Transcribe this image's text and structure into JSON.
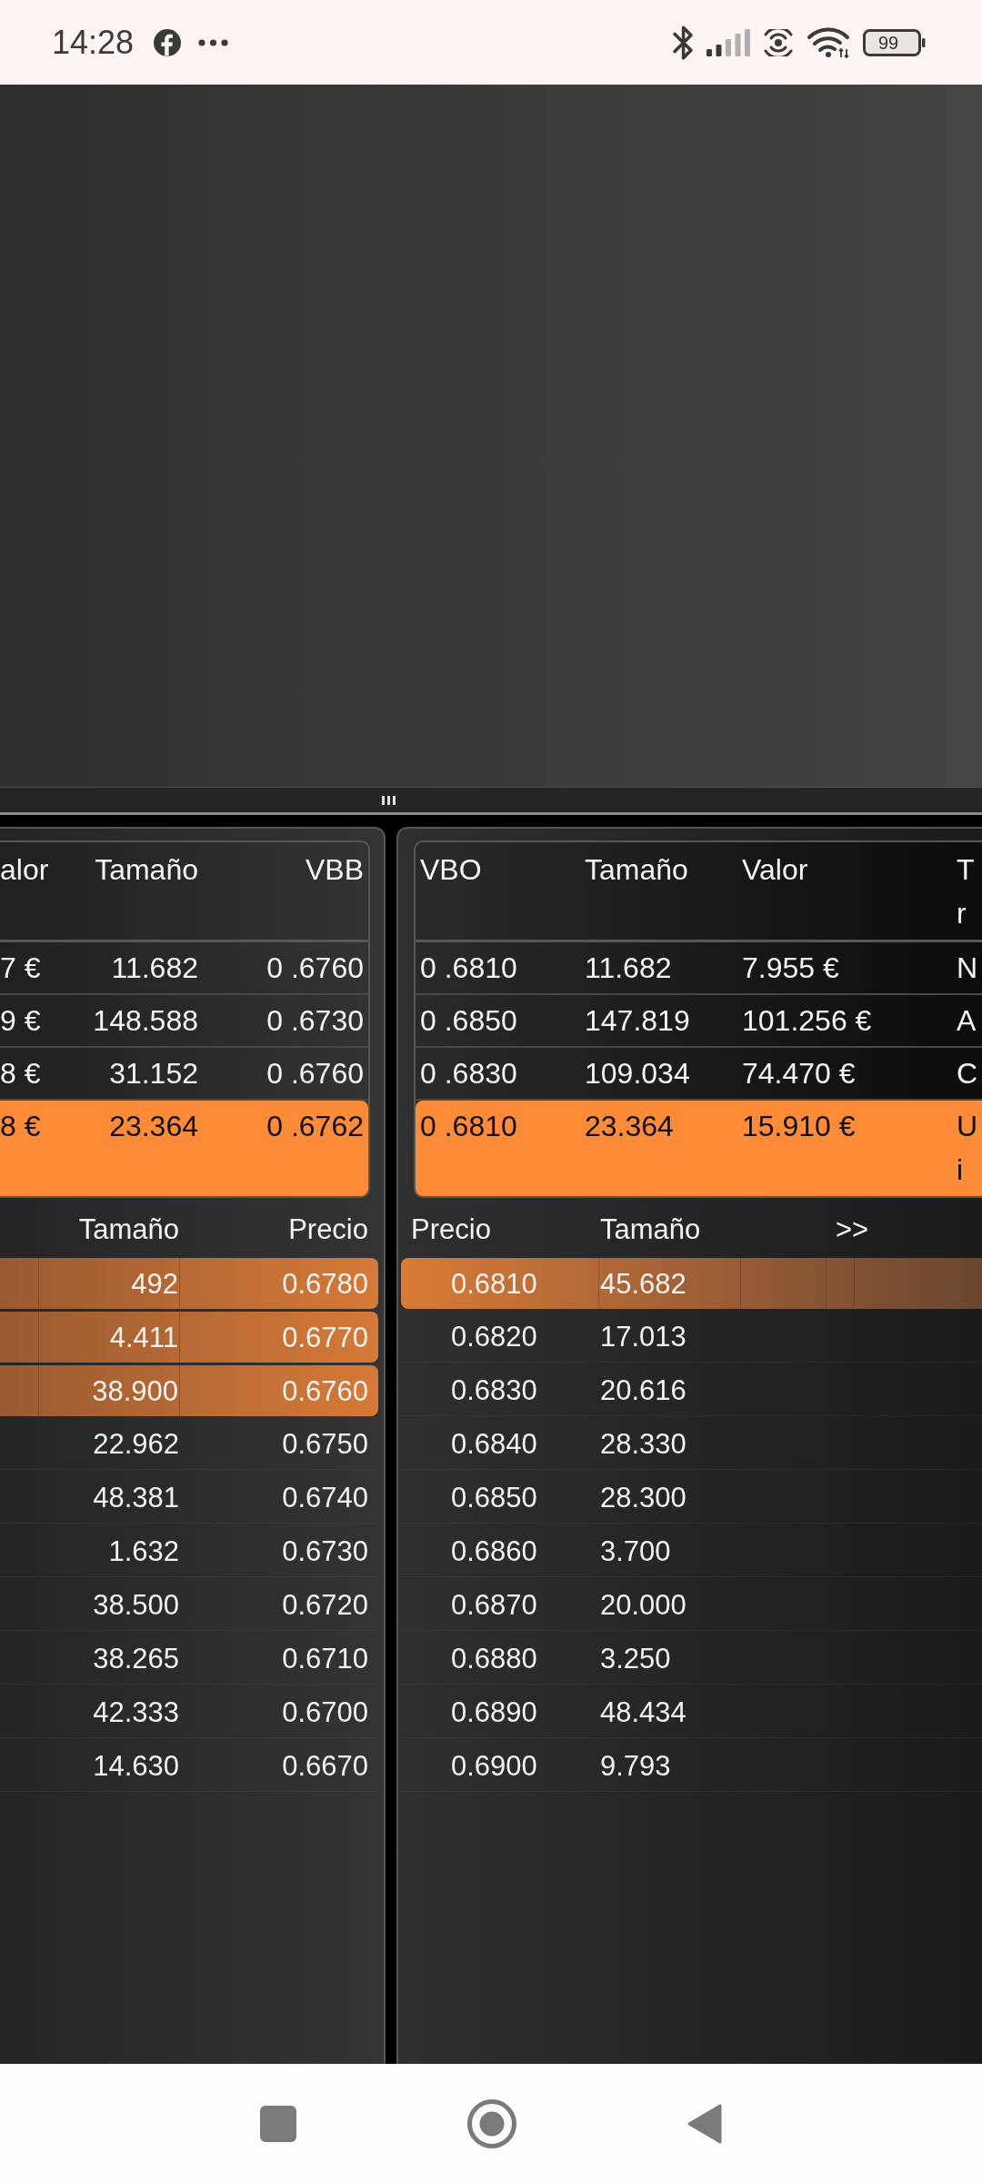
{
  "status_bar": {
    "time": "14:28",
    "battery": "99"
  },
  "left_panel": {
    "summary": {
      "columns": [
        "alor",
        "Tamaño",
        "VBB"
      ],
      "rows": [
        {
          "cells": [
            "7 €",
            "11.682",
            "0 .6760"
          ],
          "selected": false
        },
        {
          "cells": [
            "9 €",
            "148.588",
            "0 .6730"
          ],
          "selected": false
        },
        {
          "cells": [
            "8 €",
            "31.152",
            "0 .6760"
          ],
          "selected": false
        },
        {
          "cells": [
            "8 €",
            "23.364",
            "0 .6762"
          ],
          "selected": true
        }
      ]
    },
    "order_book": {
      "columns": [
        "Tamaño",
        "Precio"
      ],
      "rows": [
        {
          "size": "492",
          "price": "0.6780",
          "highlighted": true
        },
        {
          "size": "4.411",
          "price": "0.6770",
          "highlighted": true
        },
        {
          "size": "38.900",
          "price": "0.6760",
          "highlighted": true
        },
        {
          "size": "22.962",
          "price": "0.6750",
          "highlighted": false
        },
        {
          "size": "48.381",
          "price": "0.6740",
          "highlighted": false
        },
        {
          "size": "1.632",
          "price": "0.6730",
          "highlighted": false
        },
        {
          "size": "38.500",
          "price": "0.6720",
          "highlighted": false
        },
        {
          "size": "38.265",
          "price": "0.6710",
          "highlighted": false
        },
        {
          "size": "42.333",
          "price": "0.6700",
          "highlighted": false
        },
        {
          "size": "14.630",
          "price": "0.6670",
          "highlighted": false
        }
      ]
    }
  },
  "right_panel": {
    "summary": {
      "columns": [
        "VBO",
        "Tamaño",
        "Valor",
        "T r"
      ],
      "rows": [
        {
          "cells": [
            "0 .6810",
            "11.682",
            "7.955 €",
            "N"
          ],
          "selected": false
        },
        {
          "cells": [
            "0 .6850",
            "147.819",
            "101.256 €",
            "A"
          ],
          "selected": false
        },
        {
          "cells": [
            "0 .6830",
            "109.034",
            "74.470 €",
            "C"
          ],
          "selected": false
        },
        {
          "cells": [
            "0 .6810",
            "23.364",
            "15.910 €",
            "U i"
          ],
          "selected": true
        }
      ]
    },
    "order_book": {
      "columns": [
        "Precio",
        "Tamaño"
      ],
      "more_button": ">>",
      "rows": [
        {
          "price": "0.6810",
          "size": "45.682",
          "highlighted": true
        },
        {
          "price": "0.6820",
          "size": "17.013",
          "highlighted": false
        },
        {
          "price": "0.6830",
          "size": "20.616",
          "highlighted": false
        },
        {
          "price": "0.6840",
          "size": "28.330",
          "highlighted": false
        },
        {
          "price": "0.6850",
          "size": "28.300",
          "highlighted": false
        },
        {
          "price": "0.6860",
          "size": "3.700",
          "highlighted": false
        },
        {
          "price": "0.6870",
          "size": "20.000",
          "highlighted": false
        },
        {
          "price": "0.6880",
          "size": "3.250",
          "highlighted": false
        },
        {
          "price": "0.6890",
          "size": "48.434",
          "highlighted": false
        },
        {
          "price": "0.6900",
          "size": "9.793",
          "highlighted": false
        }
      ]
    }
  }
}
